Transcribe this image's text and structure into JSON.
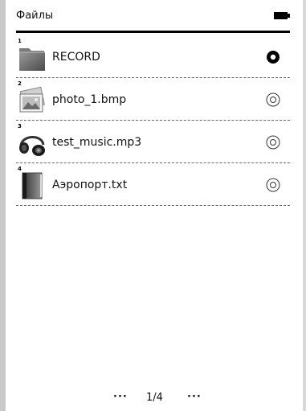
{
  "header": {
    "title": "Файлы",
    "battery_icon": "battery-full-icon"
  },
  "files": [
    {
      "index": "1",
      "name": "RECORD",
      "icon": "folder-icon",
      "selected": true
    },
    {
      "index": "2",
      "name": "photo_1.bmp",
      "icon": "image-icon",
      "selected": false
    },
    {
      "index": "3",
      "name": "test_music.mp3",
      "icon": "headphones-icon",
      "selected": false
    },
    {
      "index": "4",
      "name": "Аэропорт.txt",
      "icon": "book-icon",
      "selected": false
    }
  ],
  "pager": {
    "prev": "···",
    "page": "1/4",
    "next": "···"
  }
}
